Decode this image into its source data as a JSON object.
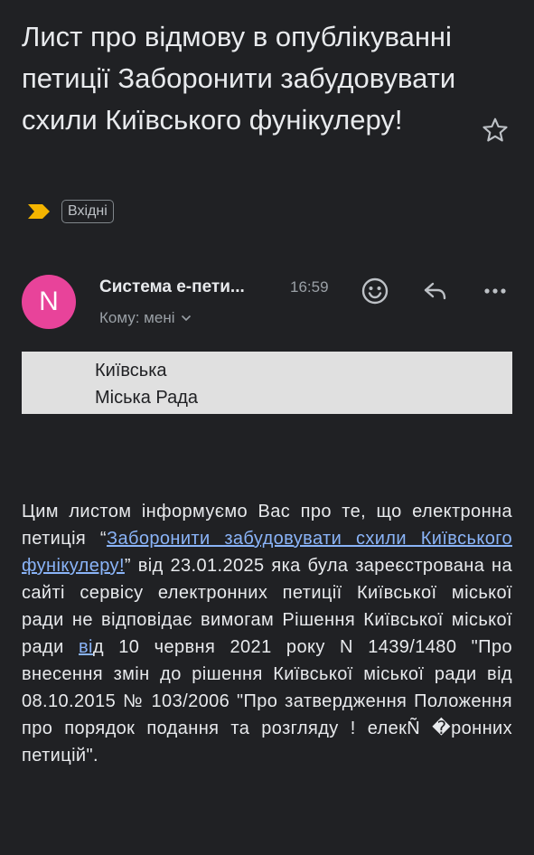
{
  "email": {
    "subject": "Лист про відмову в опублікуванні петиції Заборонити забудовувати схили Київського фунікулеру!",
    "label": "Вхідні",
    "sender_initial": "N",
    "sender_name": "Система е-пети...",
    "time": "16:59",
    "recipient": "Кому: мені",
    "banner_line1": "Київська",
    "banner_line2": "Міська Рада",
    "body": {
      "p1": "Цим листом інформуємо Вас про те, що електронна петиція “",
      "link1": "Заборонити забудовувати схили Київського фунікулеру!",
      "p2": "”  від 23.01.2025 яка була  зареєстрована на сайті сервісу електронних петиції Київської міської ради не відповідає вимогам Рішення Київської міської ради ",
      "link2": "ві",
      "p3": "д 10 червня 2021 року N 1439/1480 \"Про внесення змін до рішення Київської міської ради від 08.10.2015 № 103/2006 \"Про затвердження Положення про порядок подання та розгляду ! елекÑ �ронних петицій\"."
    }
  },
  "icons": {
    "star": "star-outline-icon",
    "important": "important-marker-icon",
    "emoji": "emoji-reaction-icon",
    "reply": "reply-icon",
    "more": "more-horizontal-icon",
    "chevron": "chevron-down-icon"
  },
  "colors": {
    "background": "#202124",
    "avatar": "#e8439a",
    "important": "#f4b400",
    "link": "#8ab4f8",
    "banner": "#e0e0e0"
  }
}
